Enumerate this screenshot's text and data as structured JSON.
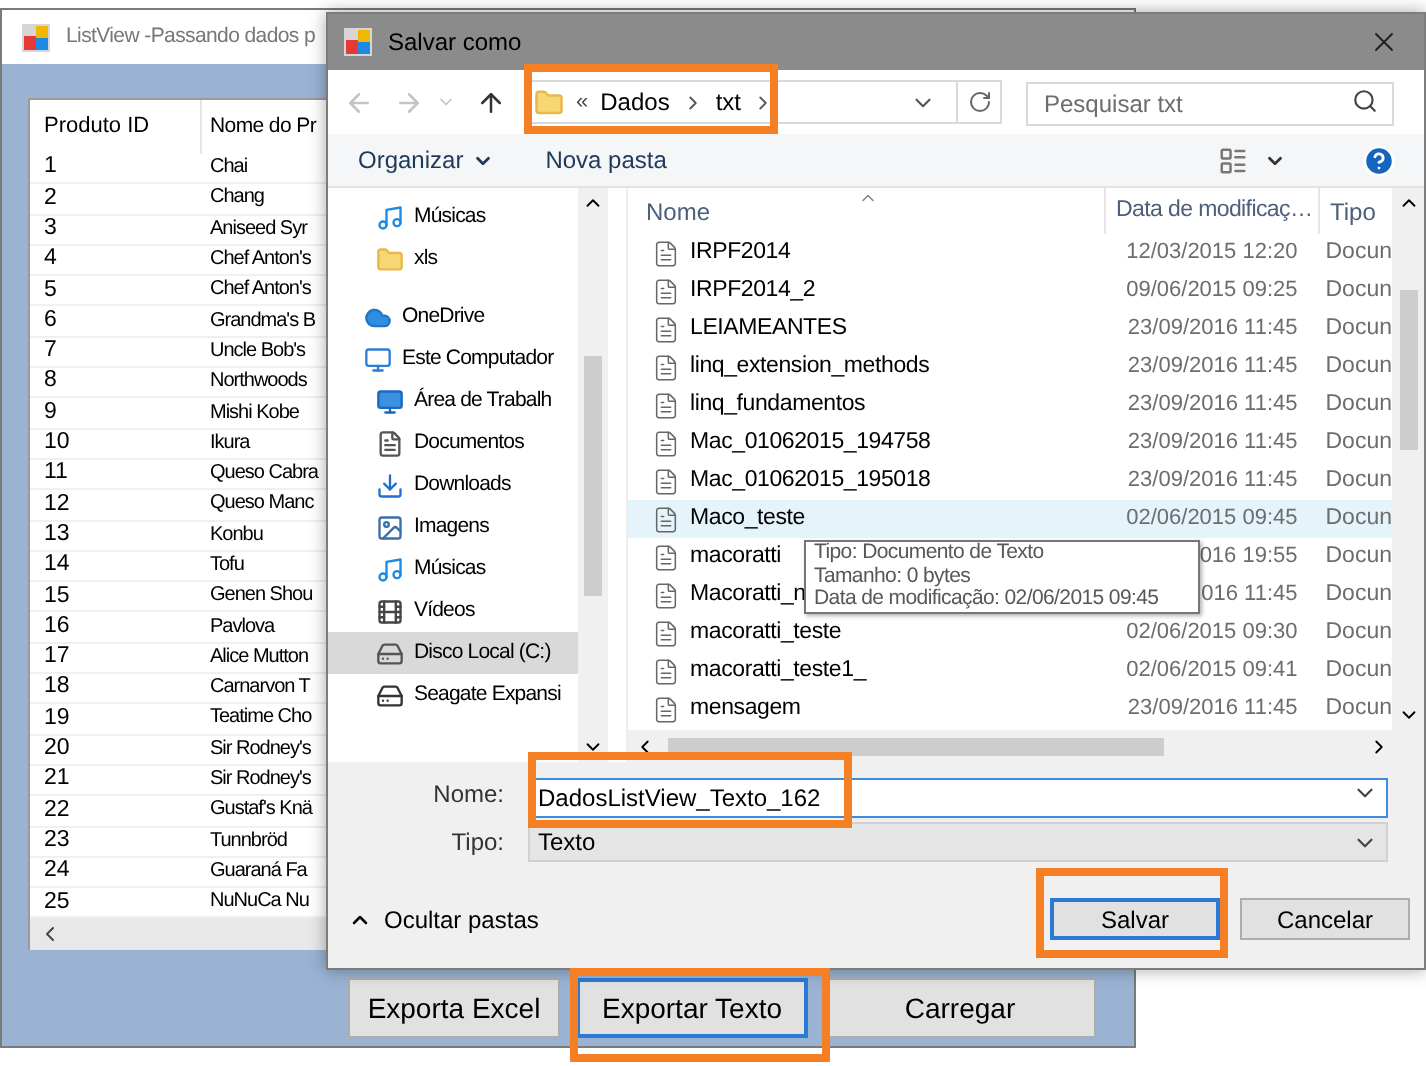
{
  "back_window": {
    "title": "ListView -Passando dados p",
    "list": {
      "columns": [
        "Produto ID",
        "Nome do Pr"
      ],
      "rows": [
        {
          "id": "1",
          "name": "Chai"
        },
        {
          "id": "2",
          "name": "Chang"
        },
        {
          "id": "3",
          "name": "Aniseed Syr"
        },
        {
          "id": "4",
          "name": "Chef Anton's"
        },
        {
          "id": "5",
          "name": "Chef Anton's"
        },
        {
          "id": "6",
          "name": "Grandma's B"
        },
        {
          "id": "7",
          "name": "Uncle Bob's"
        },
        {
          "id": "8",
          "name": "Northwoods"
        },
        {
          "id": "9",
          "name": "Mishi Kobe"
        },
        {
          "id": "10",
          "name": "Ikura"
        },
        {
          "id": "11",
          "name": "Queso Cabra"
        },
        {
          "id": "12",
          "name": "Queso Manc"
        },
        {
          "id": "13",
          "name": "Konbu"
        },
        {
          "id": "14",
          "name": "Tofu"
        },
        {
          "id": "15",
          "name": "Genen Shou"
        },
        {
          "id": "16",
          "name": "Pavlova"
        },
        {
          "id": "17",
          "name": "Alice Mutton"
        },
        {
          "id": "18",
          "name": "Carnarvon T"
        },
        {
          "id": "19",
          "name": "Teatime Cho"
        },
        {
          "id": "20",
          "name": "Sir Rodney's"
        },
        {
          "id": "21",
          "name": "Sir Rodney's"
        },
        {
          "id": "22",
          "name": "Gustaf's Knä"
        },
        {
          "id": "23",
          "name": "Tunnbröd"
        },
        {
          "id": "24",
          "name": "Guaraná Fa"
        },
        {
          "id": "25",
          "name": "NuNuCa Nu"
        }
      ]
    },
    "buttons": [
      {
        "label": "Exporta Excel",
        "focused": false
      },
      {
        "label": "Exportar Texto",
        "focused": true
      },
      {
        "label": "Carregar",
        "focused": false
      }
    ]
  },
  "dialog": {
    "title": "Salvar como",
    "overflow_mark": "«",
    "path": [
      "Dados",
      "txt"
    ],
    "search": {
      "placeholder": "Pesquisar txt"
    },
    "toolbar": [
      {
        "label": "Organizar",
        "dropdown": true
      },
      {
        "label": "Nova pasta",
        "dropdown": false
      }
    ],
    "nav": [
      {
        "children": [
          {
            "label": "Músicas",
            "kind": "music",
            "selected": false
          },
          {
            "label": "xls",
            "kind": "folder",
            "selected": false
          }
        ]
      },
      {
        "label": "OneDrive",
        "kind": "cloud",
        "selected": false
      },
      {
        "label": "Este Computador",
        "kind": "computer",
        "selected": false,
        "children": [
          {
            "label": "Área de Trabalh",
            "kind": "desktop",
            "selected": false
          },
          {
            "label": "Documentos",
            "kind": "documents",
            "selected": false
          },
          {
            "label": "Downloads",
            "kind": "downloads",
            "selected": false
          },
          {
            "label": "Imagens",
            "kind": "pictures",
            "selected": false
          },
          {
            "label": "Músicas",
            "kind": "music",
            "selected": false
          },
          {
            "label": "Vídeos",
            "kind": "videos",
            "selected": false
          },
          {
            "label": "Disco Local (C:)",
            "kind": "drive",
            "selected": true
          },
          {
            "label": "Seagate Expansi",
            "kind": "external-drive",
            "selected": false
          }
        ]
      }
    ],
    "files": {
      "columns": [
        "Nome",
        "Data de modificaç…",
        "Tipo"
      ],
      "rows": [
        {
          "name": "IRPF2014",
          "date": "12/03/2015 12:20",
          "type": "Docun",
          "highlighted": false
        },
        {
          "name": "IRPF2014_2",
          "date": "09/06/2015 09:25",
          "type": "Docun",
          "highlighted": false
        },
        {
          "name": "LEIAMEANTES",
          "date": "23/09/2016 11:45",
          "type": "Docun",
          "highlighted": false
        },
        {
          "name": "linq_extension_methods",
          "date": "23/09/2016 11:45",
          "type": "Docun",
          "highlighted": false
        },
        {
          "name": "linq_fundamentos",
          "date": "23/09/2016 11:45",
          "type": "Docun",
          "highlighted": false
        },
        {
          "name": "Mac_01062015_194758",
          "date": "23/09/2016 11:45",
          "type": "Docun",
          "highlighted": false
        },
        {
          "name": "Mac_01062015_195018",
          "date": "23/09/2016 11:45",
          "type": "Docun",
          "highlighted": false
        },
        {
          "name": "Maco_teste",
          "date": "02/06/2015 09:45",
          "type": "Docun",
          "highlighted": true
        },
        {
          "name": "macoratti",
          "date": "016 19:55",
          "type": "Docun",
          "highlighted": false
        },
        {
          "name": "Macoratti_n",
          "date": "016 11:45",
          "type": "Docun",
          "highlighted": false
        },
        {
          "name": "macoratti_teste",
          "date": "02/06/2015 09:30",
          "type": "Docun",
          "highlighted": false
        },
        {
          "name": "macoratti_teste1_",
          "date": "02/06/2015 09:41",
          "type": "Docun",
          "highlighted": false
        },
        {
          "name": "mensagem",
          "date": "23/09/2016 11:45",
          "type": "Docun",
          "highlighted": false
        }
      ]
    },
    "tooltip": [
      "Tipo: Documento de Texto",
      "Tamanho: 0 bytes",
      "Data de modificação: 02/06/2015 09:45"
    ],
    "name_field": {
      "label": "Nome:",
      "value": "DadosListView_Texto_162"
    },
    "type_field": {
      "label": "Tipo:",
      "value": "Texto"
    },
    "hide_folders": "Ocultar pastas",
    "buttons": [
      {
        "label": "Salvar",
        "default": true
      },
      {
        "label": "Cancelar",
        "default": false
      }
    ]
  }
}
